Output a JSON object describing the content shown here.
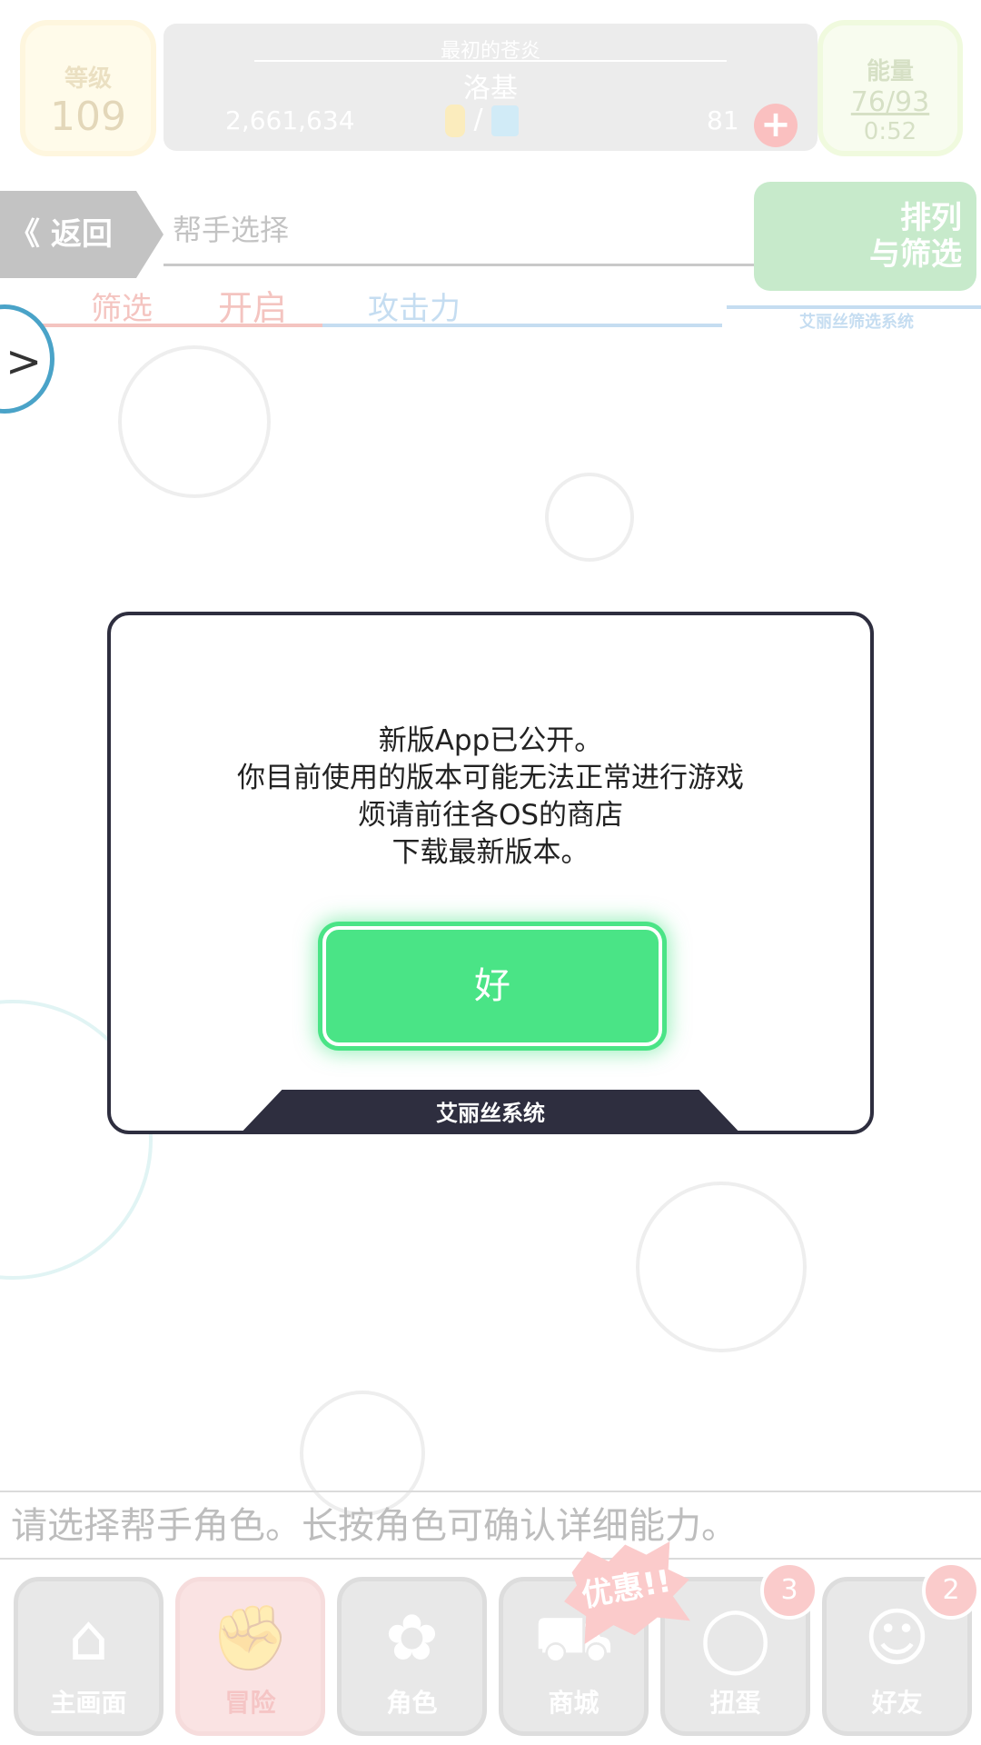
{
  "top_bar": {
    "level_label": "等级",
    "level_value": "109",
    "player_title": "最初的苍炎",
    "player_name": "洛基",
    "money": "2,661,634",
    "currency_separator": "/",
    "stone_count": "81",
    "add_icon": "plus-icon",
    "energy_label": "能量",
    "energy_value": "76/93",
    "energy_timer": "0:52"
  },
  "header": {
    "back_label": "《 返回",
    "title": "帮手选择",
    "sort_label_line1": "排列",
    "sort_label_line2": "与筛选",
    "sort_subtitle": "艾丽丝筛选系统",
    "filter_label": "筛选",
    "filter_state": "开启",
    "sort_key": "攻击力"
  },
  "side_toggle": {
    "icon": "chevron-right-icon",
    "glyph": ">"
  },
  "hint": "请选择帮手角色。长按角色可确认详细能力。",
  "nav": {
    "items": [
      {
        "label": "主画面",
        "icon": "home-icon",
        "glyph": "⌂"
      },
      {
        "label": "冒险",
        "icon": "handshake-icon",
        "glyph": "✊",
        "active": true
      },
      {
        "label": "角色",
        "icon": "rabbit-icon",
        "glyph": "✿"
      },
      {
        "label": "商城",
        "icon": "cart-icon",
        "glyph": "⛟"
      },
      {
        "label": "扭蛋",
        "icon": "egg-icon",
        "glyph": "◯",
        "badge": "3"
      },
      {
        "label": "好友",
        "icon": "friends-icon",
        "glyph": "☺",
        "badge": "2"
      }
    ],
    "promo_label": "优惠!!"
  },
  "dialog": {
    "message_lines": [
      "新版App已公开。",
      "你目前使用的版本可能无法正常进行游戏",
      "烦请前往各OS的商店",
      "下载最新版本。"
    ],
    "ok_label": "好",
    "footer_label": "艾丽丝系统"
  },
  "colors": {
    "ok_button": "#4ae486",
    "dialog_border": "#2e2e3f",
    "filter_red": "#e0574a",
    "sort_blue": "#5b9ed8"
  }
}
